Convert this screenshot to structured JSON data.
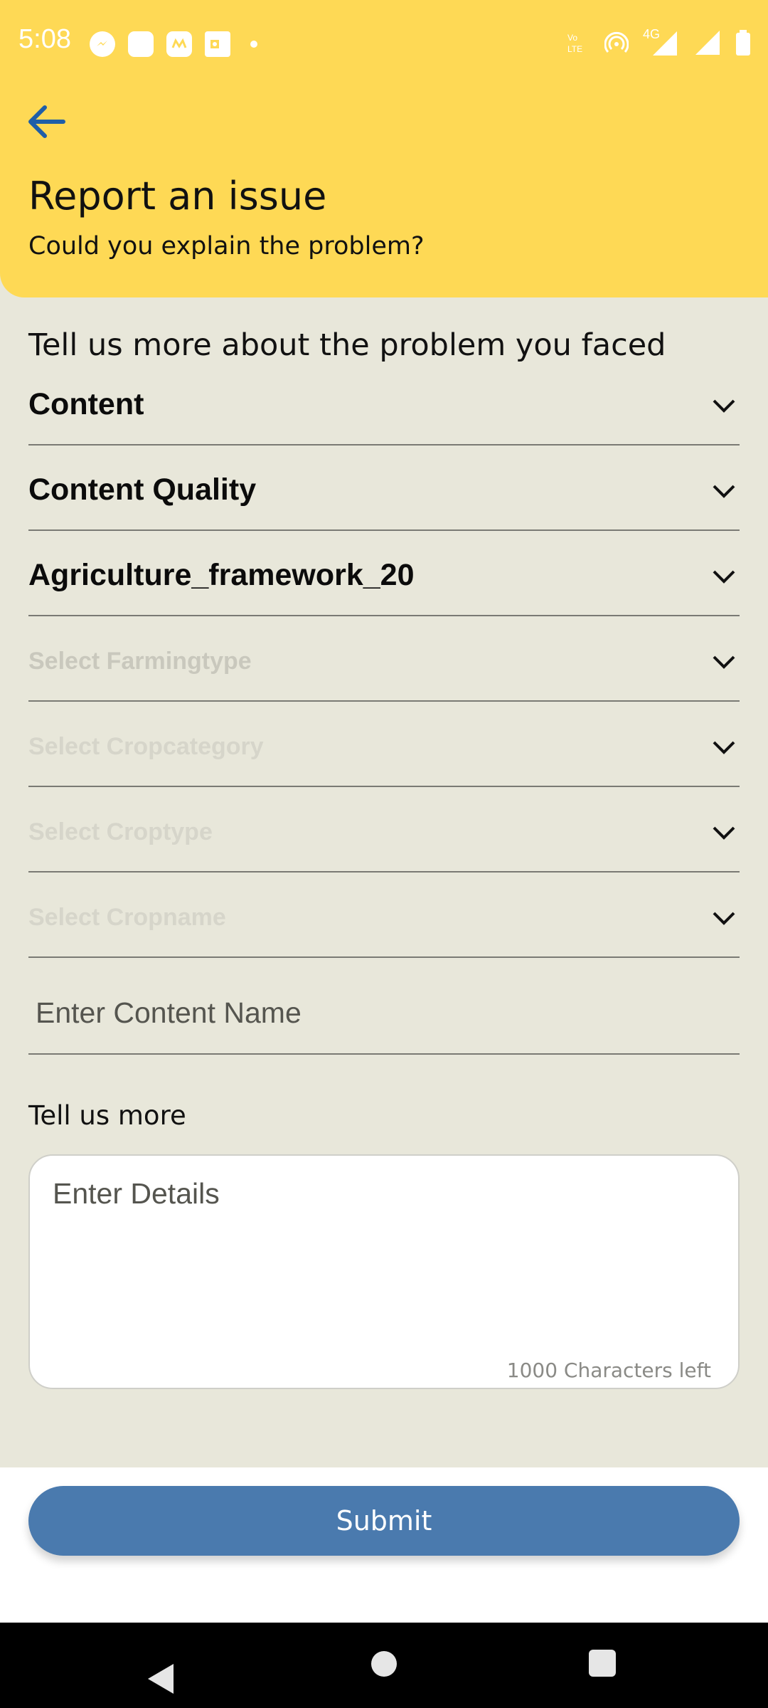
{
  "status_bar": {
    "time": "5:08",
    "left_icons": [
      "messenger-icon",
      "app-icon",
      "myntra-icon",
      "outlook-icon"
    ],
    "right_icons": [
      "volte-icon",
      "hotspot-icon",
      "4g-signal-icon",
      "signal-icon",
      "battery-icon"
    ],
    "network_label": "4G"
  },
  "header": {
    "title": "Report an issue",
    "subtitle": "Could you explain the problem?"
  },
  "form": {
    "prompt": "Tell us more about the problem you faced",
    "dropdowns": [
      {
        "value": "Content",
        "placeholder": ""
      },
      {
        "value": "Content Quality",
        "placeholder": ""
      },
      {
        "value": "Agriculture_framework_20",
        "placeholder": ""
      },
      {
        "value": "",
        "placeholder": "Select Farmingtype"
      },
      {
        "value": "",
        "placeholder": "Select Cropcategory"
      },
      {
        "value": "",
        "placeholder": "Select Croptype"
      },
      {
        "value": "",
        "placeholder": "Select Cropname"
      }
    ],
    "content_name_placeholder": "Enter Content Name",
    "tell_more_label": "Tell us more",
    "details_placeholder": "Enter Details",
    "chars_left": "1000 Characters left"
  },
  "footer": {
    "submit_label": "Submit"
  },
  "colors": {
    "header_bg": "#fed955",
    "page_bg": "#e8e7da",
    "submit_bg": "#4a7aae",
    "back_arrow": "#1f5ea8"
  }
}
